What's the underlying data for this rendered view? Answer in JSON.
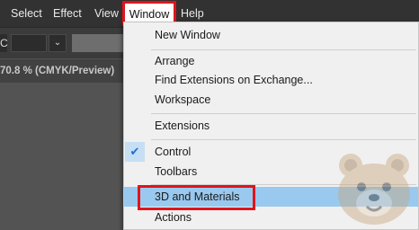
{
  "menubar": {
    "items": [
      {
        "label": "Select"
      },
      {
        "label": "Effect"
      },
      {
        "label": "View"
      },
      {
        "label": "Window",
        "active": true
      },
      {
        "label": "Help"
      }
    ]
  },
  "controlbar": {
    "arrow_glyph": "C",
    "dropdown_glyph": "⌄"
  },
  "document": {
    "tab_label": "70.8 % (CMYK/Preview)"
  },
  "window_menu": {
    "items": [
      {
        "label": "New Window"
      },
      {
        "label": "Arrange"
      },
      {
        "label": "Find Extensions on Exchange..."
      },
      {
        "label": "Workspace"
      },
      {
        "label": "Extensions"
      },
      {
        "label": "Control",
        "checked": true
      },
      {
        "label": "Toolbars"
      },
      {
        "label": "3D and Materials",
        "highlighted": true
      },
      {
        "label": "Actions"
      }
    ]
  },
  "colors": {
    "highlight_box": "#e0141b",
    "hover_row": "#99c9ef",
    "menubar_bg": "#323232"
  }
}
